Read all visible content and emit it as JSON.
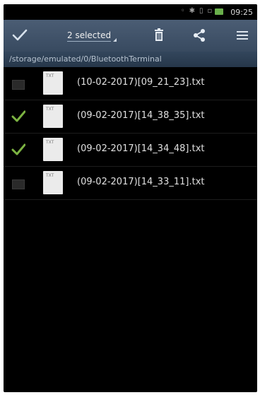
{
  "statusbar": {
    "time": "09:25",
    "icons": [
      "wifi-icon",
      "bluetooth-icon",
      "vibrate-icon",
      "sim-icon",
      "signal-icon",
      "battery-icon"
    ]
  },
  "actionbar": {
    "selected_label": "2 selected",
    "actions": [
      "check-all-icon",
      "delete-icon",
      "share-icon",
      "menu-icon"
    ]
  },
  "path": "/storage/emulated/0/BluetoothTerminal",
  "files": [
    {
      "name": "(10-02-2017)[09_21_23].txt",
      "checked": false,
      "icon_text": "TXT"
    },
    {
      "name": "(09-02-2017)[14_38_35].txt",
      "checked": true,
      "icon_text": "TXT"
    },
    {
      "name": "(09-02-2017)[14_34_48].txt",
      "checked": true,
      "icon_text": "TXT"
    },
    {
      "name": "(09-02-2017)[14_33_11].txt",
      "checked": false,
      "icon_text": "TXT"
    }
  ],
  "colors": {
    "actionbar": "#44566d",
    "pathbar": "#2c3d51",
    "check": "#7cb342",
    "background": "#000000"
  }
}
